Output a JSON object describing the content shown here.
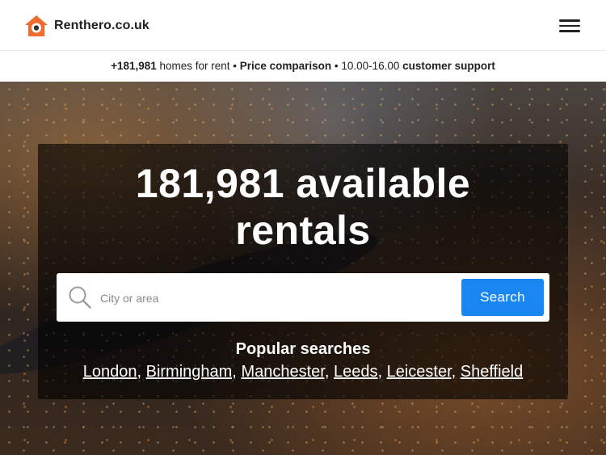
{
  "header": {
    "logo_text": "Renthero.co.uk",
    "logo_icon": "house-eye-icon",
    "menu_icon": "hamburger-icon"
  },
  "infobar": {
    "count": "+181,981",
    "homes_text": " homes for rent • ",
    "price_text": "Price comparison",
    "hours_text": " • 10.00-16.00 ",
    "support_text": "customer support"
  },
  "hero": {
    "title_line1": "181,981 available",
    "title_line2": "rentals",
    "search": {
      "placeholder": "City or area",
      "value": "",
      "button_label": "Search"
    },
    "popular": {
      "title": "Popular searches",
      "links": [
        {
          "label": "London",
          "sep": ", "
        },
        {
          "label": "Birmingham",
          "sep": ", "
        },
        {
          "label": "Manchester",
          "sep": ", "
        },
        {
          "label": "Leeds",
          "sep": ", "
        },
        {
          "label": "Leicester",
          "sep": ", "
        },
        {
          "label": "Sheffield",
          "sep": ""
        }
      ]
    }
  },
  "colors": {
    "brand_orange": "#f26a2e",
    "accent_blue": "#1a86f2",
    "text_dark": "#222222"
  }
}
